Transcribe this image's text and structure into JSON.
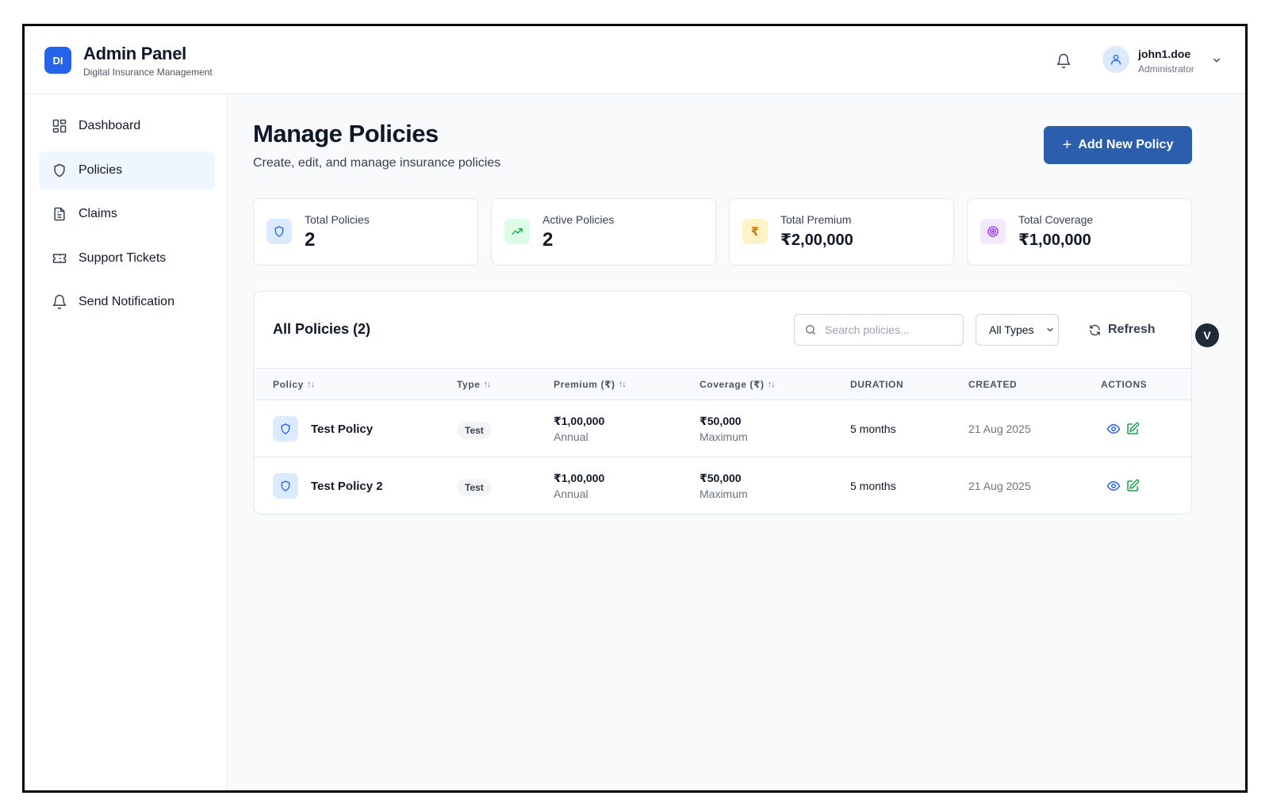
{
  "brand": {
    "logo": "DI",
    "title": "Admin Panel",
    "subtitle": "Digital Insurance Management"
  },
  "user": {
    "name": "john1.doe",
    "role": "Administrator"
  },
  "sidebar": {
    "items": [
      {
        "label": "Dashboard",
        "icon": "dashboard-icon"
      },
      {
        "label": "Policies",
        "icon": "shield-icon",
        "active": true
      },
      {
        "label": "Claims",
        "icon": "document-icon"
      },
      {
        "label": "Support Tickets",
        "icon": "ticket-icon"
      },
      {
        "label": "Send Notification",
        "icon": "bell-icon"
      }
    ]
  },
  "page": {
    "title": "Manage Policies",
    "subtitle": "Create, edit, and manage insurance policies",
    "add_button": "Add New Policy"
  },
  "stats": [
    {
      "label": "Total Policies",
      "value": "2",
      "icon": "shield-icon",
      "bg": "#dbeafe"
    },
    {
      "label": "Active Policies",
      "value": "2",
      "icon": "trending-up-icon",
      "bg": "#dcfce7"
    },
    {
      "label": "Total Premium",
      "value": "₹2,00,000",
      "icon": "rupee-icon",
      "bg": "#fef3c7"
    },
    {
      "label": "Total Coverage",
      "value": "₹1,00,000",
      "icon": "target-icon",
      "bg": "#f3e8ff"
    }
  ],
  "table": {
    "title": "All Policies (2)",
    "search_placeholder": "Search policies...",
    "type_filter": "All Types",
    "refresh_label": "Refresh",
    "columns": [
      "Policy",
      "Type",
      "Premium (₹)",
      "Coverage (₹)",
      "DURATION",
      "CREATED",
      "ACTIONS"
    ],
    "sort_glyph": "↑↓",
    "rows": [
      {
        "name": "Test Policy",
        "type": "Test",
        "premium": "₹1,00,000",
        "premium_sub": "Annual",
        "coverage": "₹50,000",
        "coverage_sub": "Maximum",
        "duration": "5 months",
        "created": "21 Aug 2025"
      },
      {
        "name": "Test Policy 2",
        "type": "Test",
        "premium": "₹1,00,000",
        "premium_sub": "Annual",
        "coverage": "₹50,000",
        "coverage_sub": "Maximum",
        "duration": "5 months",
        "created": "21 Aug 2025"
      }
    ]
  },
  "float_badge": "V",
  "colors": {
    "accent": "#2b5fad",
    "view": "#2563eb",
    "edit": "#16a34a"
  }
}
